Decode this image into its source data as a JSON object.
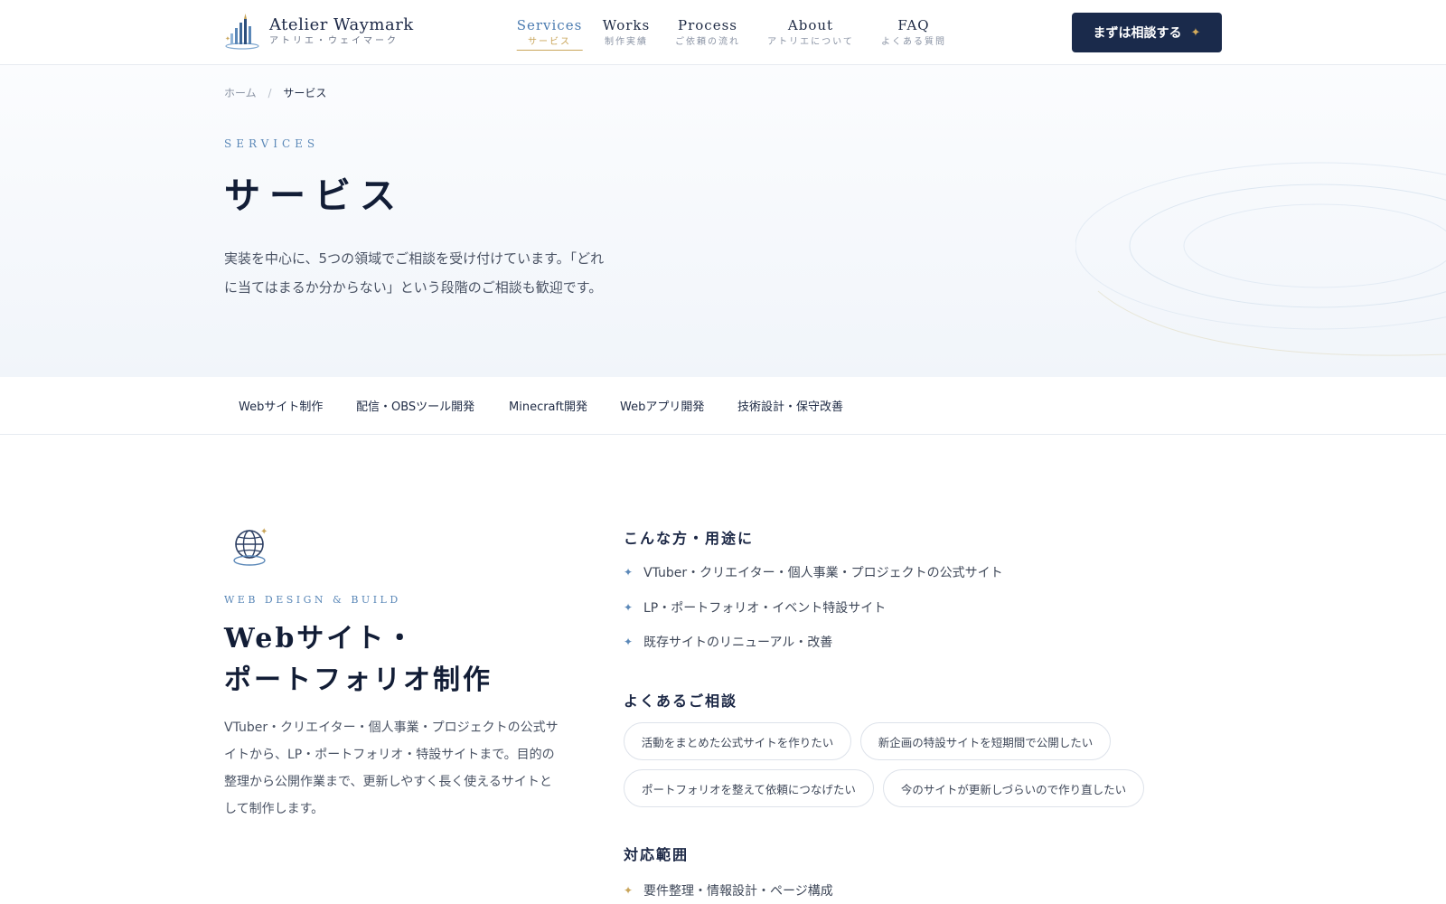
{
  "header": {
    "logo_title": "Atelier Waymark",
    "logo_sub": "アトリエ・ウェイマーク",
    "nav": [
      {
        "en": "Services",
        "jp": "サービス",
        "active": true
      },
      {
        "en": "Works",
        "jp": "制作実績",
        "active": false
      },
      {
        "en": "Process",
        "jp": "ご依頼の流れ",
        "active": false
      },
      {
        "en": "About",
        "jp": "アトリエについて",
        "active": false
      },
      {
        "en": "FAQ",
        "jp": "よくある質問",
        "active": false
      }
    ],
    "cta_label": "まずは相談する",
    "cta_icon": "sparkle-icon"
  },
  "breadcrumb": {
    "home": "ホーム",
    "separator": "/",
    "current": "サービス"
  },
  "hero": {
    "eyebrow": "SERVICES",
    "title": "サービス",
    "desc_line1": "実装を中心に、5つの領域でご相談を受け付けています。「どれ",
    "desc_line2": "に当てはまるか分からない」という段階のご相談も歓迎です。"
  },
  "tabs": [
    "Webサイト制作",
    "配信・OBSツール開発",
    "Minecraft開発",
    "Webアプリ開発",
    "技術設計・保守改善"
  ],
  "service": {
    "icon": "globe-icon",
    "eyebrow": "WEB DESIGN & BUILD",
    "title_line1": "Webサイト・",
    "title_line2": "ポートフォリオ制作",
    "desc_lines": [
      "VTuber・クリエイター・個人事業・プロジェクトの公式サ",
      "イトから、LP・ポートフォリオ・特設サイトまで。目的の",
      "整理から公開作業まで、更新しやすく長く使えるサイトと",
      "して制作します。"
    ],
    "use_cases_heading": "こんな方・用途に",
    "use_cases": [
      "VTuber・クリエイター・個人事業・プロジェクトの公式サイト",
      "LP・ポートフォリオ・イベント特設サイト",
      "既存サイトのリニューアル・改善"
    ],
    "consult_heading": "よくあるご相談",
    "consults": [
      "活動をまとめた公式サイトを作りたい",
      "新企画の特設サイトを短期間で公開したい",
      "ポートフォリオを整えて依頼につなげたい",
      "今のサイトが更新しづらいので作り直したい"
    ],
    "scope_heading": "対応範囲",
    "scope": [
      "要件整理・情報設計・ページ構成"
    ]
  },
  "colors": {
    "navy": "#1a2a4b",
    "accent_blue": "#5b88b8",
    "gold": "#c9a55a"
  }
}
